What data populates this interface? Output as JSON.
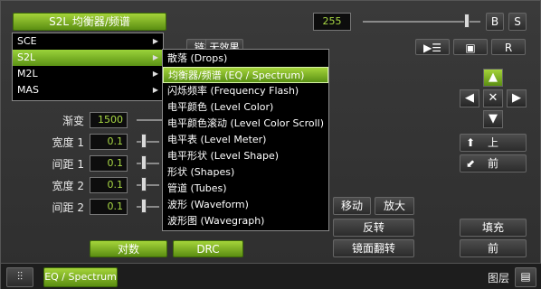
{
  "header": {
    "effect_button": "S2L 均衡器/频谱",
    "master_value": "255",
    "b_button": "B",
    "s_button": "S",
    "r_button": "R"
  },
  "tabs_partial": [
    "链接",
    "无效果"
  ],
  "params": {
    "fade_label": "渐变",
    "fade_value": "1500",
    "width1_label": "宽度 1",
    "width1_value": "0.1",
    "gap1_label": "间距 1",
    "gap1_value": "0.1",
    "width2_label": "宽度 2",
    "width2_value": "0.1",
    "gap2_label": "间距 2",
    "gap2_value": "0.1"
  },
  "right_controls": {
    "up_label": "上",
    "front_label": "前",
    "move_label": "移动",
    "zoom_label": "放大",
    "invert_label": "反转",
    "fill_label": "填充",
    "mirror_label": "镜面翻转",
    "front2_label": "前"
  },
  "bottom_buttons": {
    "log_label": "对数",
    "drc_label": "DRC"
  },
  "bottombar": {
    "active_tab": "EQ / Spectrum",
    "layers_label": "图层"
  },
  "menu": {
    "items": [
      {
        "label": "SCE",
        "active": false
      },
      {
        "label": "S2L",
        "active": true
      },
      {
        "label": "M2L",
        "active": false
      },
      {
        "label": "MAS",
        "active": false
      }
    ]
  },
  "submenu": {
    "items": [
      {
        "label": "散落 (Drops)",
        "active": false
      },
      {
        "label": "均衡器/频谱 (EQ / Spectrum)",
        "active": true
      },
      {
        "label": "闪烁频率 (Frequency Flash)",
        "active": false
      },
      {
        "label": "电平颜色 (Level Color)",
        "active": false
      },
      {
        "label": "电平颜色滚动 (Level Color Scroll)",
        "active": false
      },
      {
        "label": "电平表 (Level Meter)",
        "active": false
      },
      {
        "label": "电平形状 (Level Shape)",
        "active": false
      },
      {
        "label": "形状 (Shapes)",
        "active": false
      },
      {
        "label": "管道 (Tubes)",
        "active": false
      },
      {
        "label": "波形 (Waveform)",
        "active": false
      },
      {
        "label": "波形图 (Wavegraph)",
        "active": false
      }
    ]
  },
  "colors": {
    "accent_green": "#8bd32e",
    "value_text": "#a9d944"
  }
}
